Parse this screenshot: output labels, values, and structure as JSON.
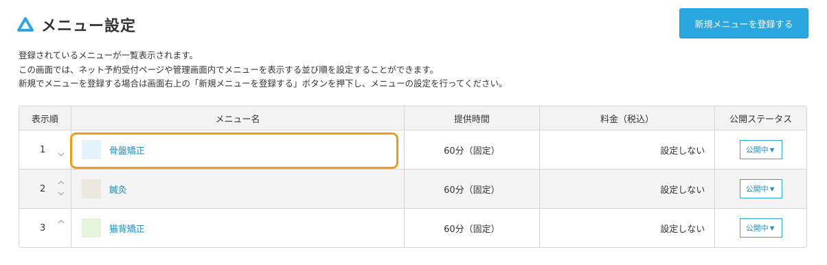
{
  "header": {
    "title": "メニュー設定",
    "icon": "triangle-logo-icon",
    "register_button": "新規メニューを登録する"
  },
  "description": [
    "登録されているメニューが一覧表示されます。",
    "この画面では、ネット予約受付ページや管理画面内でメニューを表示する並び順を設定することができます。",
    "新規でメニューを登録する場合は画面右上の「新規メニューを登録する」ボタンを押下し、メニューの設定を行ってください。"
  ],
  "table": {
    "columns": [
      "表示順",
      "メニュー名",
      "提供時間",
      "料金（税込）",
      "公開ステータス"
    ],
    "rows": [
      {
        "order": "1",
        "name": "骨盤矯正",
        "swatch": "#e3f2fb",
        "time": "60分（固定）",
        "price": "設定しない",
        "status": "公開中▼",
        "arrow_up": false,
        "arrow_down": true
      },
      {
        "order": "2",
        "name": "鍼灸",
        "swatch": "#ece6dd",
        "time": "60分（固定）",
        "price": "設定しない",
        "status": "公開中▼",
        "arrow_up": true,
        "arrow_down": true
      },
      {
        "order": "3",
        "name": "猫背矯正",
        "swatch": "#e6f4dc",
        "time": "60分（固定）",
        "price": "設定しない",
        "status": "公開中▼",
        "arrow_up": true,
        "arrow_down": false
      }
    ]
  },
  "colors": {
    "accent": "#2ba7e0",
    "link": "#1e8fc7",
    "highlight": "#f39a12"
  }
}
